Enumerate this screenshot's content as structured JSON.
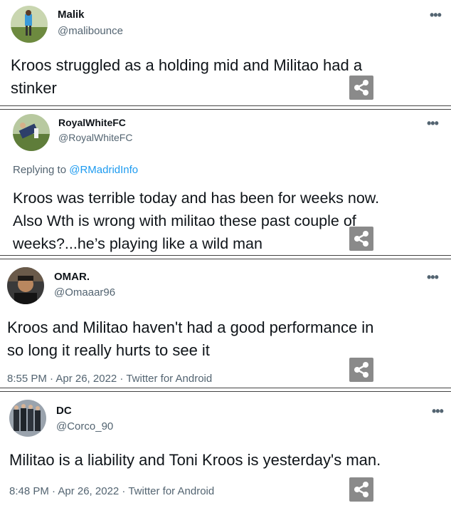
{
  "tweets": [
    {
      "name": "Malik",
      "handle": "@malibounce",
      "text": "Kroos struggled as a holding mid and Militao had a\nstinker"
    },
    {
      "name": "RoyalWhiteFC",
      "handle": "@RoyalWhiteFC",
      "reply_prefix": "Replying to",
      "reply_mention": "@RMadridInfo",
      "text": "Kroos was terrible today and has been for weeks now.\nAlso Wth is wrong with militao these past couple of\nweeks?...he’s playing like a wild man"
    },
    {
      "name": "OMAR.",
      "handle": "@Omaaar96",
      "text": "Kroos and Militao haven't had a good performance in\nso long it really hurts to see it",
      "meta": "8:55 PM · Apr 26, 2022 · Twitter for Android"
    },
    {
      "name": "DC",
      "handle": "@Corco_90",
      "text": "Militao is a liability and Toni Kroos is yesterday's man.",
      "meta": "8:48 PM · Apr 26, 2022 · Twitter for Android"
    }
  ],
  "more_glyph": "•••",
  "icons": {
    "more": "more-horizontal-icon",
    "share": "share-icon",
    "avatar": "avatar-photo"
  },
  "colors": {
    "handle": "#536471",
    "mention": "#1d9bf0",
    "share_bg": "#8a8a8a"
  }
}
